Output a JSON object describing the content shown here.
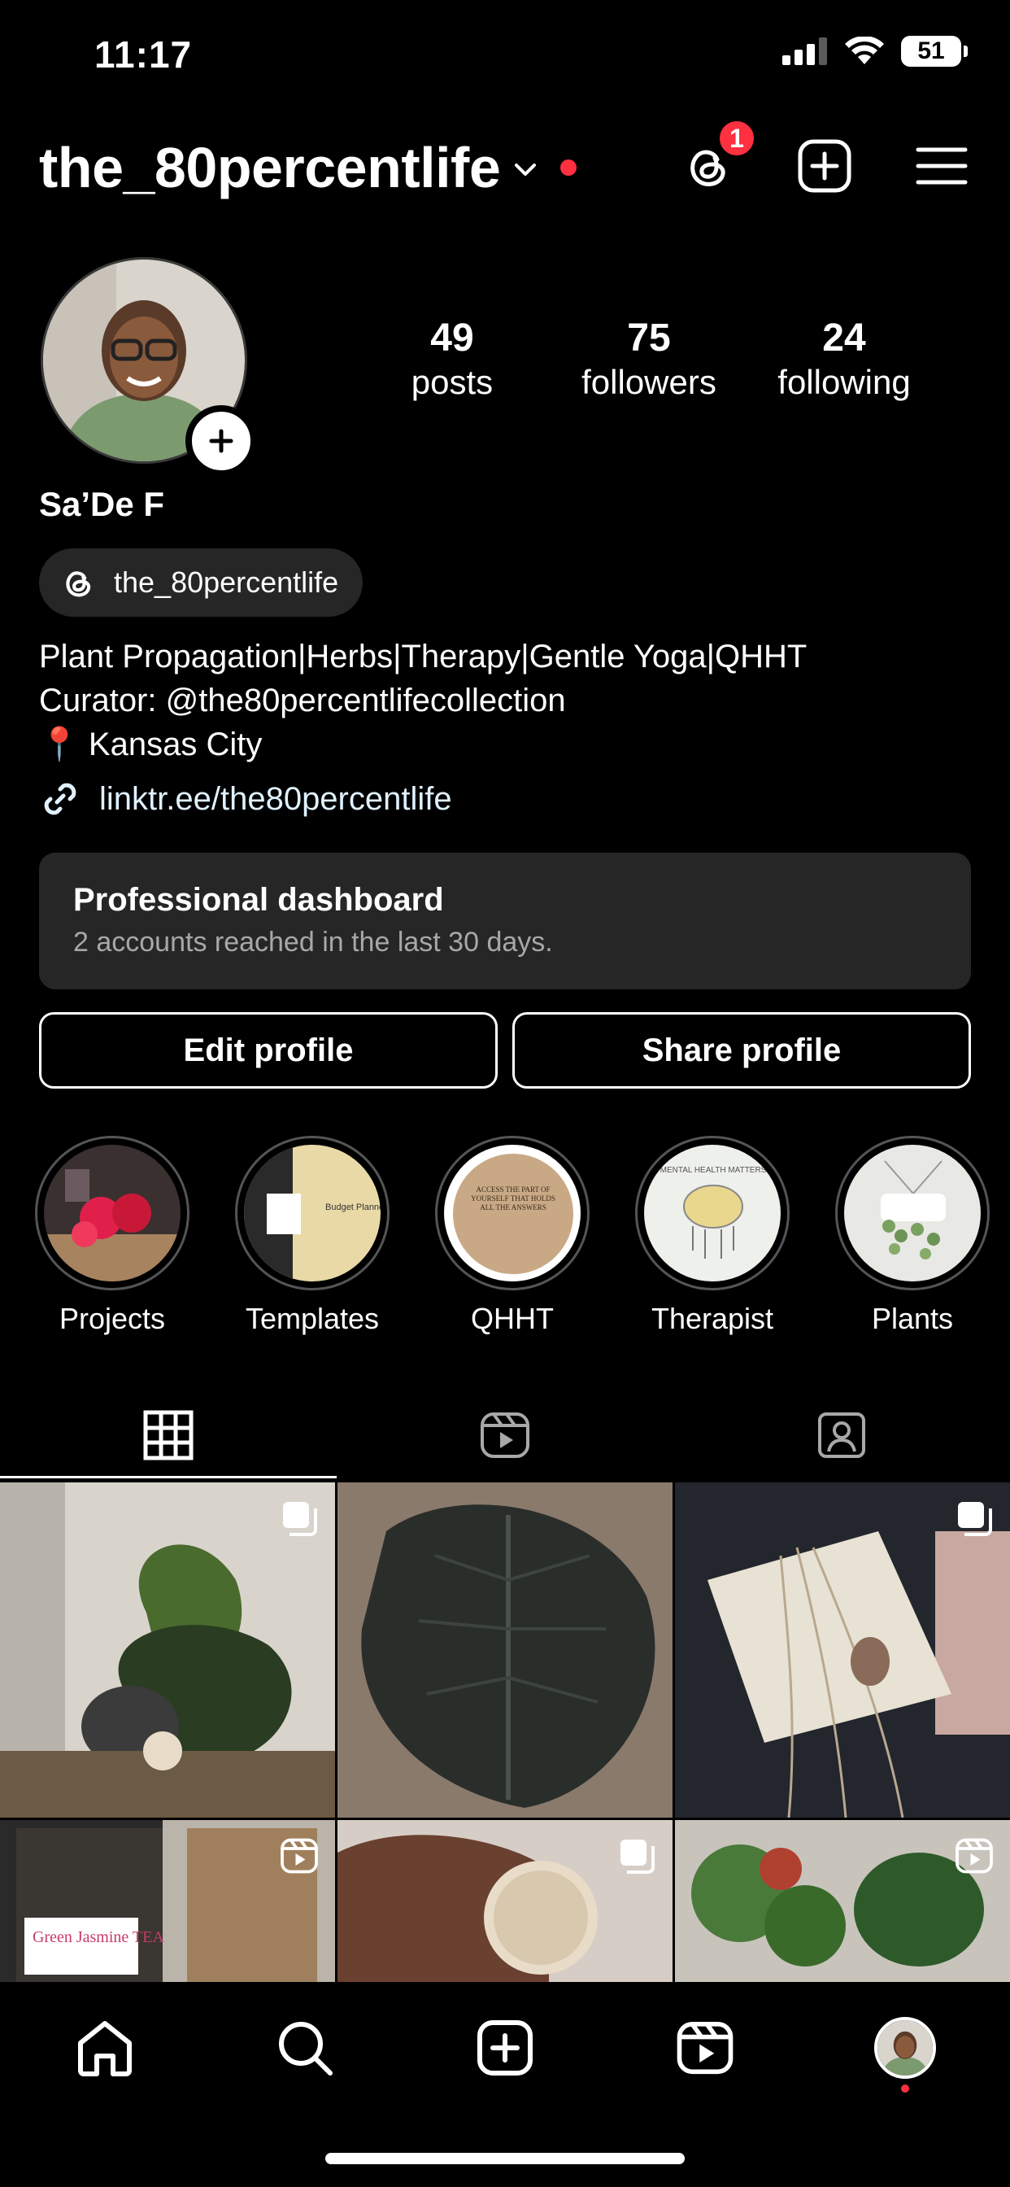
{
  "status_bar": {
    "time": "11:17",
    "battery": "51"
  },
  "header": {
    "username": "the_80percentlife",
    "notification_count": "1"
  },
  "stats": [
    {
      "number": "49",
      "label": "posts"
    },
    {
      "number": "75",
      "label": "followers"
    },
    {
      "number": "24",
      "label": "following"
    }
  ],
  "profile": {
    "display_name": "Sa’De F",
    "threads_handle": "the_80percentlife",
    "bio": [
      "Plant Propagation|Herbs|Therapy|Gentle Yoga|QHHT",
      "Curator: @the80percentlifecollection",
      "📍 Kansas City"
    ],
    "link": "linktr.ee/the80percentlife"
  },
  "dashboard": {
    "title": "Professional dashboard",
    "subtitle": "2 accounts reached in the last 30 days."
  },
  "buttons": {
    "edit": "Edit profile",
    "share": "Share profile"
  },
  "highlights": [
    {
      "label": "Projects"
    },
    {
      "label": "Templates"
    },
    {
      "label": "QHHT"
    },
    {
      "label": "Therapist"
    },
    {
      "label": "Plants"
    }
  ],
  "highlight_text": {
    "templates": "Budget Planner",
    "qhht": "ACCESS THE PART OF YOURSELF THAT HOLDS ALL THE ANSWERS",
    "therapist": "MENTAL HEALTH MATTERS",
    "green_tea": "Green Jasmine TEA"
  },
  "tabs": [
    "grid-icon",
    "reels-icon",
    "tagged-icon"
  ],
  "colors": {
    "accent_red": "#ff3040",
    "surface": "#262626",
    "link": "#e0f1ff"
  }
}
